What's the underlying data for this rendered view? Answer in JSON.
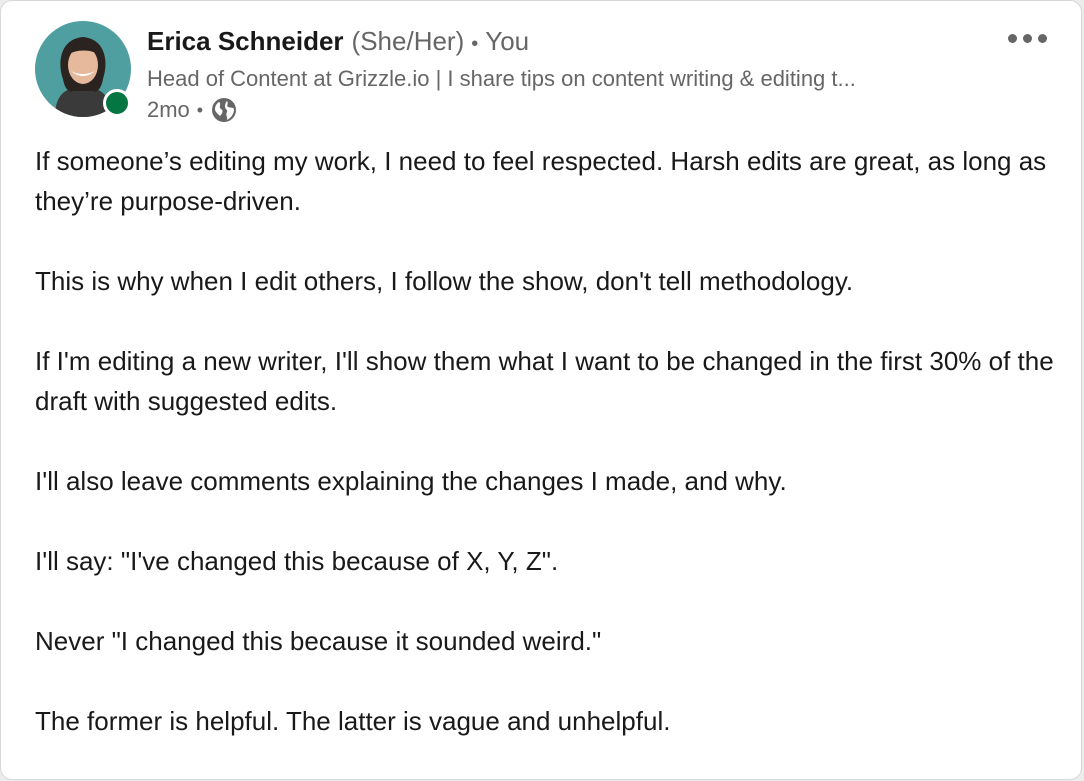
{
  "author": {
    "name": "Erica Schneider",
    "pronouns": "(She/Her)",
    "separator": "•",
    "relation": "You",
    "headline": "Head of Content at Grizzle.io | I share tips on content writing & editing t...",
    "timestamp": "2mo",
    "meta_separator": "•",
    "visibility_icon": "globe-icon",
    "presence_status": "online",
    "presence_color": "#057642"
  },
  "actions": {
    "more_icon": "more-horizontal-icon"
  },
  "post": {
    "paragraphs": [
      "If someone’s editing my work, I need to feel respected. Harsh edits are great, as long as they’re purpose-driven.",
      "This is why when I edit others, I follow the show, don't tell methodology.",
      "If I'm editing a new writer, I'll show them what I want to be changed in the first 30% of the draft with suggested edits.",
      "I'll also leave comments explaining the changes I made, and why.",
      "I'll say: \"I've changed this because of X, Y, Z\".",
      "Never \"I changed this because it sounded weird.\"",
      "The former is helpful. The latter is vague and unhelpful."
    ]
  },
  "colors": {
    "text_primary": "#191919",
    "text_secondary": "#666666",
    "avatar_background": "#4f9ea0"
  }
}
